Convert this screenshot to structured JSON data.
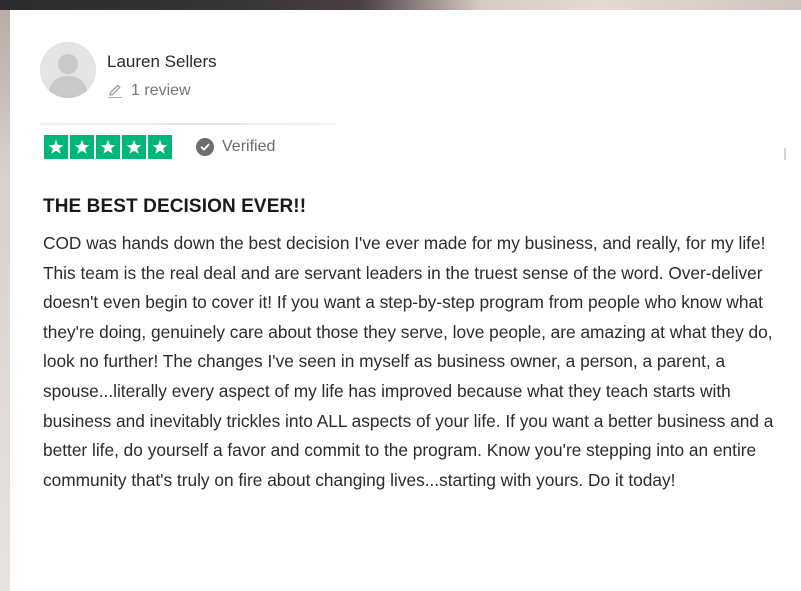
{
  "reviewer": {
    "name": "Lauren Sellers",
    "review_count": "1 review",
    "avatar_icon": "user-silhouette-icon"
  },
  "rating": {
    "stars": 5,
    "max_stars": 5,
    "star_color": "#00b67a",
    "verified_label": "Verified"
  },
  "review": {
    "title": "THE BEST DECISION EVER!!",
    "body": "COD was hands down the best decision I've ever made for my business, and really, for my life! This team is the real deal and are servant leaders in the truest sense of the word. Over-deliver doesn't even begin to cover it! If you want a step-by-step program from people who know what they're doing, genuinely care about those they serve, love people, are amazing at what they do, look no further! The changes I've seen in myself as business owner, a person, a parent, a spouse...literally every aspect of my life has improved because what they teach starts with business and inevitably trickles into ALL aspects of your life. If you want a better business and a better life, do yourself a favor and commit to the program. Know you're stepping into an entire community that's truly on fire about changing lives...starting with yours. Do it today!"
  }
}
